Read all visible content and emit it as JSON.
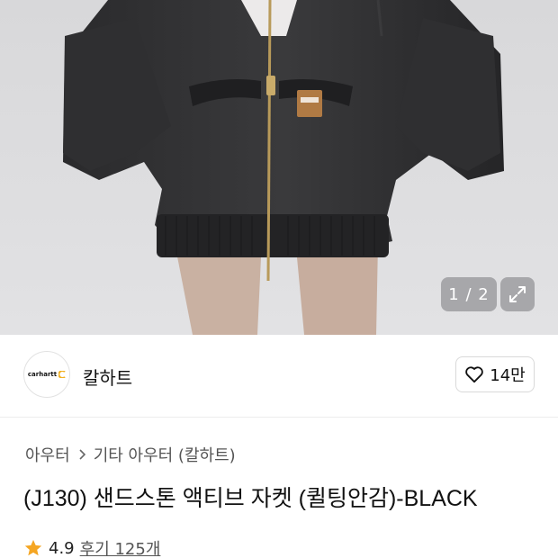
{
  "gallery": {
    "counter": "1 / 2",
    "current_image": 1,
    "total_images": 2,
    "patch_text": "carhartt"
  },
  "icons": {
    "expand": "expand-arrows-icon",
    "heart": "heart-outline-icon",
    "star": "star-icon",
    "chevron": "chevron-right-icon"
  },
  "brand": {
    "logo_text": "carhartt",
    "name": "칼하트"
  },
  "like": {
    "count": "14만"
  },
  "breadcrumb": {
    "items": [
      "아우터",
      "기타 아우터 (칼하트)"
    ]
  },
  "product": {
    "title": "(J130) 샌드스톤 액티브 자켓 (퀼팅안감)-BLACK",
    "rating": "4.9",
    "reviews": "후기 125개"
  },
  "colors": {
    "star": "#f5a623",
    "image_bg": "#dcdcde",
    "jacket": "#2b2b2d"
  }
}
